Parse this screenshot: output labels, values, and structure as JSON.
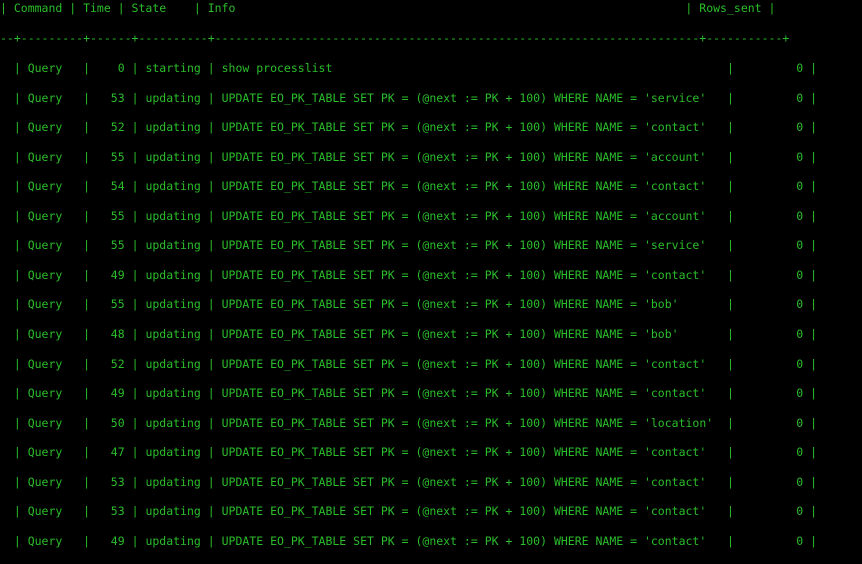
{
  "colors": {
    "background": "#000000",
    "text": "#2bbd2b"
  },
  "header": {
    "text": "| Command | Time | State    | Info                                                                 | Rows_sent |"
  },
  "separator": {
    "text": "--+---------+------+----------+----------------------------------------------------------------------+-----------+"
  },
  "rows": [
    {
      "command": "Query",
      "time": "0",
      "state": "starting",
      "info": "show processlist",
      "rows_sent": "0"
    },
    {
      "command": "Query",
      "time": "53",
      "state": "updating",
      "info": "UPDATE EO_PK_TABLE SET PK = (@next := PK + 100) WHERE NAME = 'service'",
      "rows_sent": "0"
    },
    {
      "command": "Query",
      "time": "52",
      "state": "updating",
      "info": "UPDATE EO_PK_TABLE SET PK = (@next := PK + 100) WHERE NAME = 'contact'",
      "rows_sent": "0"
    },
    {
      "command": "Query",
      "time": "55",
      "state": "updating",
      "info": "UPDATE EO_PK_TABLE SET PK = (@next := PK + 100) WHERE NAME = 'account'",
      "rows_sent": "0"
    },
    {
      "command": "Query",
      "time": "54",
      "state": "updating",
      "info": "UPDATE EO_PK_TABLE SET PK = (@next := PK + 100) WHERE NAME = 'contact'",
      "rows_sent": "0"
    },
    {
      "command": "Query",
      "time": "55",
      "state": "updating",
      "info": "UPDATE EO_PK_TABLE SET PK = (@next := PK + 100) WHERE NAME = 'account'",
      "rows_sent": "0"
    },
    {
      "command": "Query",
      "time": "55",
      "state": "updating",
      "info": "UPDATE EO_PK_TABLE SET PK = (@next := PK + 100) WHERE NAME = 'service'",
      "rows_sent": "0"
    },
    {
      "command": "Query",
      "time": "49",
      "state": "updating",
      "info": "UPDATE EO_PK_TABLE SET PK = (@next := PK + 100) WHERE NAME = 'contact'",
      "rows_sent": "0"
    },
    {
      "command": "Query",
      "time": "55",
      "state": "updating",
      "info": "UPDATE EO_PK_TABLE SET PK = (@next := PK + 100) WHERE NAME = 'bob'",
      "rows_sent": "0"
    },
    {
      "command": "Query",
      "time": "48",
      "state": "updating",
      "info": "UPDATE EO_PK_TABLE SET PK = (@next := PK + 100) WHERE NAME = 'bob'",
      "rows_sent": "0"
    },
    {
      "command": "Query",
      "time": "52",
      "state": "updating",
      "info": "UPDATE EO_PK_TABLE SET PK = (@next := PK + 100) WHERE NAME = 'contact'",
      "rows_sent": "0"
    },
    {
      "command": "Query",
      "time": "49",
      "state": "updating",
      "info": "UPDATE EO_PK_TABLE SET PK = (@next := PK + 100) WHERE NAME = 'contact'",
      "rows_sent": "0"
    },
    {
      "command": "Query",
      "time": "50",
      "state": "updating",
      "info": "UPDATE EO_PK_TABLE SET PK = (@next := PK + 100) WHERE NAME = 'location'",
      "rows_sent": "0"
    },
    {
      "command": "Query",
      "time": "47",
      "state": "updating",
      "info": "UPDATE EO_PK_TABLE SET PK = (@next := PK + 100) WHERE NAME = 'contact'",
      "rows_sent": "0"
    },
    {
      "command": "Query",
      "time": "53",
      "state": "updating",
      "info": "UPDATE EO_PK_TABLE SET PK = (@next := PK + 100) WHERE NAME = 'contact'",
      "rows_sent": "0"
    },
    {
      "command": "Query",
      "time": "53",
      "state": "updating",
      "info": "UPDATE EO_PK_TABLE SET PK = (@next := PK + 100) WHERE NAME = 'contact'",
      "rows_sent": "0"
    },
    {
      "command": "Query",
      "time": "49",
      "state": "updating",
      "info": "UPDATE EO_PK_TABLE SET PK = (@next := PK + 100) WHERE NAME = 'contact'",
      "rows_sent": "0"
    }
  ]
}
